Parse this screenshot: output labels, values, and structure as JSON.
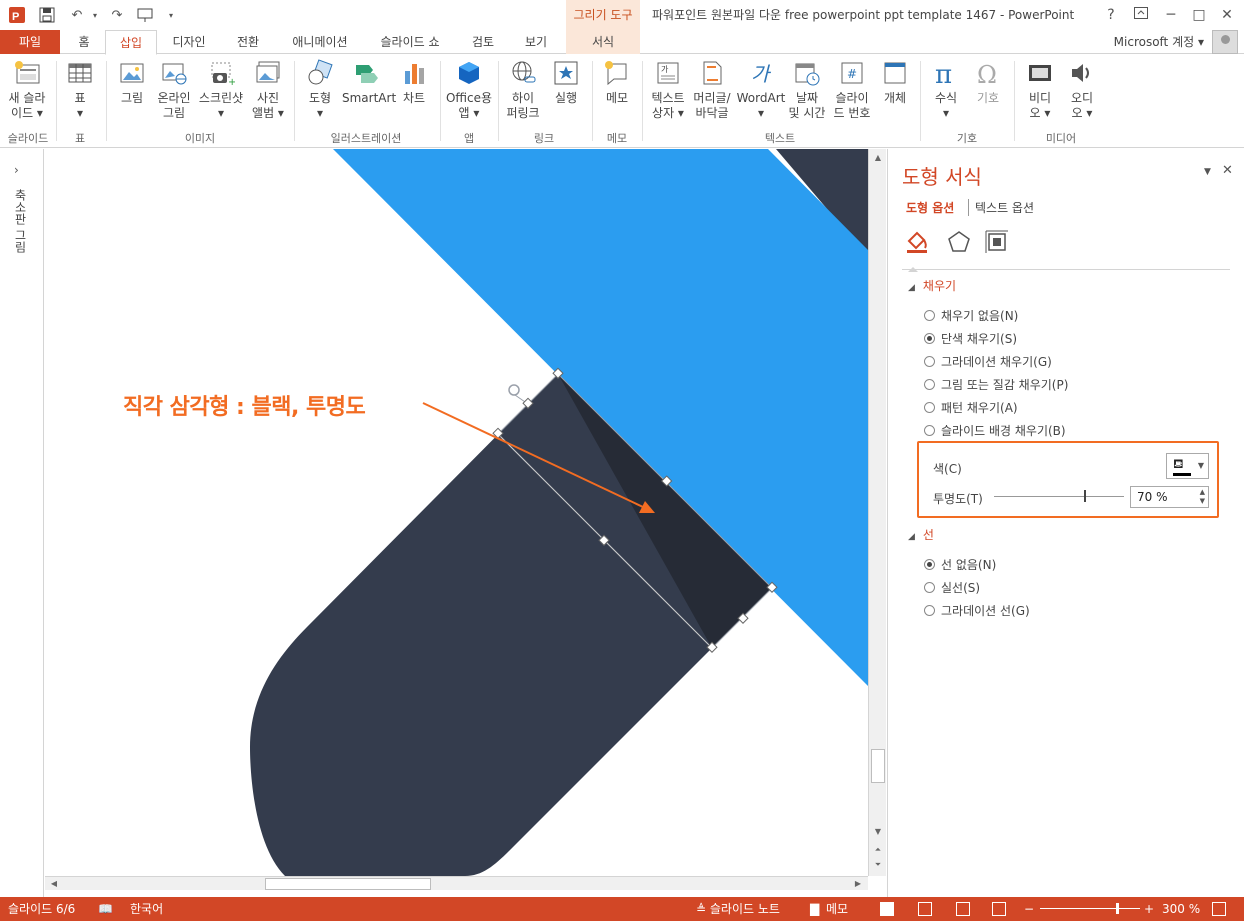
{
  "titlebar": {
    "context_tab_header": "그리기 도구",
    "window_title": "파워포인트 원본파일 다운 free powerpoint ppt template 1467 - PowerPoint",
    "help": "?",
    "minimize": "─",
    "restore": "□",
    "close": "✕"
  },
  "tabs": [
    {
      "label": "파일"
    },
    {
      "label": "홈"
    },
    {
      "label": "삽입"
    },
    {
      "label": "디자인"
    },
    {
      "label": "전환"
    },
    {
      "label": "애니메이션"
    },
    {
      "label": "슬라이드 쇼"
    },
    {
      "label": "검토"
    },
    {
      "label": "보기"
    },
    {
      "label": "서식"
    }
  ],
  "account": "Microsoft 계정 ▾",
  "ribbon": {
    "buttons": {
      "new_slide": "새 슬라\n이드 ▾",
      "table": "표\n▾",
      "picture": "그림",
      "online_picture": "온라인\n그림",
      "screenshot": "스크린샷\n▾",
      "photo_album": "사진\n앨범 ▾",
      "shapes": "도형\n▾",
      "smartart": "SmartArt",
      "chart": "차트",
      "office_app": "Office용\n앱 ▾",
      "hyperlink": "하이\n퍼링크",
      "action": "실행",
      "comment": "메모",
      "textbox": "텍스트\n상자 ▾",
      "header_footer": "머리글/\n바닥글",
      "wordart": "WordArt\n▾",
      "date_time": "날짜\n및 시간",
      "slide_number": "슬라이\n드 번호",
      "object": "개체",
      "equation": "수식\n▾",
      "symbol": "기호",
      "video": "비디\n오 ▾",
      "audio": "오디\n오 ▾"
    },
    "groups": {
      "slides": "슬라이드",
      "tables": "표",
      "images": "이미지",
      "illustrations": "일러스트레이션",
      "apps": "앱",
      "links": "링크",
      "comments": "메모",
      "text": "텍스트",
      "symbols": "기호",
      "media": "미디어"
    }
  },
  "left_pane": {
    "expand": "›",
    "label": "축소판 그림"
  },
  "slide": {
    "annotation": "직각 삼각형 : 블랙, 투명도",
    "colors": {
      "blue": "#2b9df0",
      "navy": "#343c4d",
      "dark_triangle": "#262b36",
      "annotation": "#f26c22"
    }
  },
  "format_pane": {
    "title": "도형 서식",
    "tab_shape": "도형 옵션",
    "tab_text": "텍스트 옵션",
    "fill_section": "채우기",
    "fill_options": [
      {
        "label": "채우기 없음(N)",
        "selected": false
      },
      {
        "label": "단색 채우기(S)",
        "selected": true
      },
      {
        "label": "그라데이션 채우기(G)",
        "selected": false
      },
      {
        "label": "그림 또는 질감 채우기(P)",
        "selected": false
      },
      {
        "label": "패턴 채우기(A)",
        "selected": false
      },
      {
        "label": "슬라이드 배경 채우기(B)",
        "selected": false
      }
    ],
    "color_label": "색(C)",
    "transparency_label": "투명도(T)",
    "transparency_value": "70 %",
    "transparency_fraction": 0.7,
    "line_section": "선",
    "line_options": [
      {
        "label": "선 없음(N)",
        "selected": true
      },
      {
        "label": "실선(S)",
        "selected": false
      },
      {
        "label": "그라데이션 선(G)",
        "selected": false
      }
    ]
  },
  "statusbar": {
    "slide_indicator": "슬라이드 6/6",
    "language": "한국어",
    "notes": "≜ 슬라이드 노트",
    "comments": "메모",
    "zoom": "300 %"
  }
}
